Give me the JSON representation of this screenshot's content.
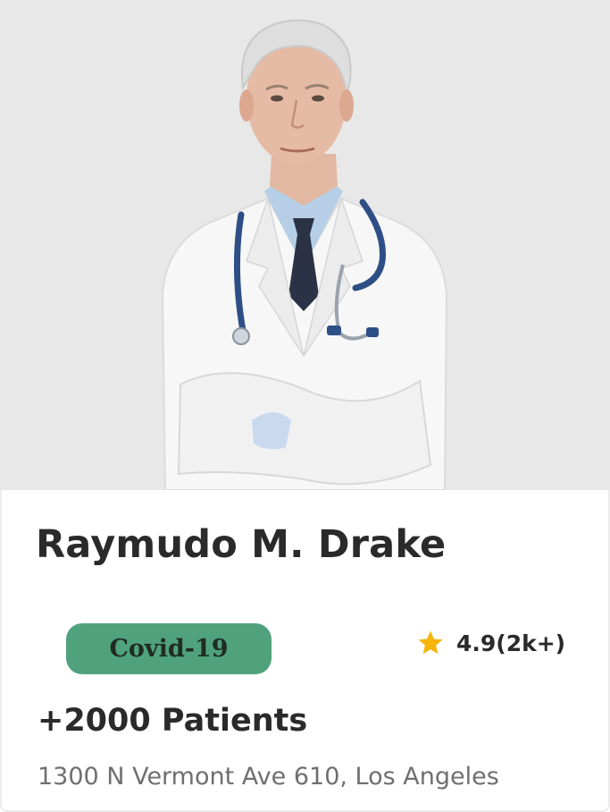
{
  "doctor": {
    "name": "Raymudo M. Drake",
    "specialty": "Covid-19",
    "rating": "4.9(2k+)",
    "patients": "+2000 Patients",
    "address": "1300 N Vermont Ave 610, Los Angeles"
  },
  "icons": {
    "rating": "star-icon"
  },
  "colors": {
    "badge_background": "#50a27d",
    "badge_text": "#1f2c24",
    "star": "#f5b50c",
    "title_text": "#2a2a2a",
    "secondary_text": "#6f6f6f",
    "photo_background": "#e8e8e8"
  }
}
